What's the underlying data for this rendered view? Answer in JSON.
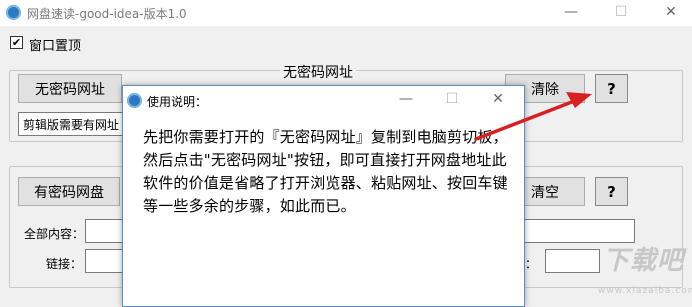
{
  "window": {
    "title": "网盘速读-good-idea-版本1.0",
    "minimize_glyph": "—",
    "maximize_glyph": "☐",
    "close_glyph": "✕"
  },
  "pin_option": {
    "checked": true,
    "check_glyph": "✔",
    "label": "窗口置顶"
  },
  "no_password_section": {
    "title": "无密码网址",
    "open_button": "无密码网址",
    "clear_button": "清除",
    "help_button": "?",
    "input_value": "剪辑版需要有网址"
  },
  "password_section": {
    "open_button": "有密码网盘",
    "clear_button": "清空",
    "help_button": "?",
    "all_content_label": "全部内容：",
    "link_label": "链接：",
    "code_label_partial": "码："
  },
  "dialog": {
    "title": "使用说明：",
    "minimize_glyph": "—",
    "maximize_glyph": "☐",
    "close_glyph": "✕",
    "body": "先把你需要打开的『无密码网址』复制到电脑剪切板，然后点击\"无密码网址\"按钮，即可直接打开网盘地址此软件的价值是省略了打开浏览器、粘贴网址、按回车键等一些多余的步骤，如此而已。"
  },
  "annotation": {
    "arrow_color": "#d92020"
  },
  "watermark": {
    "main": "下载吧",
    "sub": "www.xiazaiba.com"
  }
}
